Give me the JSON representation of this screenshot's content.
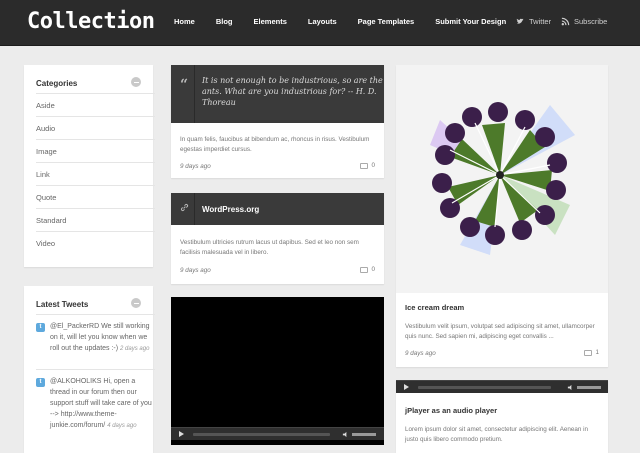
{
  "header": {
    "logo": "Collection",
    "nav": [
      "Home",
      "Blog",
      "Elements",
      "Layouts",
      "Page Templates",
      "Submit Your Design"
    ],
    "twitter_label": "Twitter",
    "subscribe_label": "Subscribe"
  },
  "sidebar": {
    "categories": {
      "title": "Categories",
      "items": [
        "Aside",
        "Audio",
        "Image",
        "Link",
        "Quote",
        "Standard",
        "Video"
      ]
    },
    "tweets": {
      "title": "Latest Tweets",
      "items": [
        {
          "text": "@El_PackerRD We still working on it, will let you know when we roll out the updates :-)",
          "time": "2 days ago"
        },
        {
          "text": "@ALKOHOLIKS Hi, open a thread in our forum then our support stuff will take care of you --> http://www.theme-junkie.com/forum/",
          "time": "4 days ago"
        }
      ]
    }
  },
  "posts": {
    "quote": {
      "quote": "It is not enough to be industrious, so are the ants. What are you industrious for? -- H. D. Thoreau",
      "body": "In quam felis, faucibus at bibendum ac, rhoncus in risus. Vestibulum egestas imperdiet cursus.",
      "date": "9 days ago",
      "comments": "0"
    },
    "link": {
      "title": "WordPress.org",
      "body": "Vestibulum ultricies rutrum lacus ut dapibus. Sed et leo non sem facilisis malesuada vel in libero.",
      "date": "9 days ago",
      "comments": "0"
    },
    "image": {
      "title": "Ice cream dream",
      "body": "Vestibulum velit ipsum, volutpat sed adipiscing sit amet, ullamcorper quis nunc. Sed sapien mi, adipiscing eget convallis ...",
      "date": "9 days ago",
      "comments": "1"
    },
    "audio": {
      "title": "jPlayer as an audio player",
      "body": "Lorem ipsum dolor sit amet, consectetur adipiscing elit. Aenean in justo quis libero commodo pretium."
    }
  },
  "colors": {
    "header_bg": "#2b2b2b",
    "page_bg": "#ececec",
    "dark_bar": "#3a3a3a",
    "twitter_blue": "#5ea9dd"
  }
}
